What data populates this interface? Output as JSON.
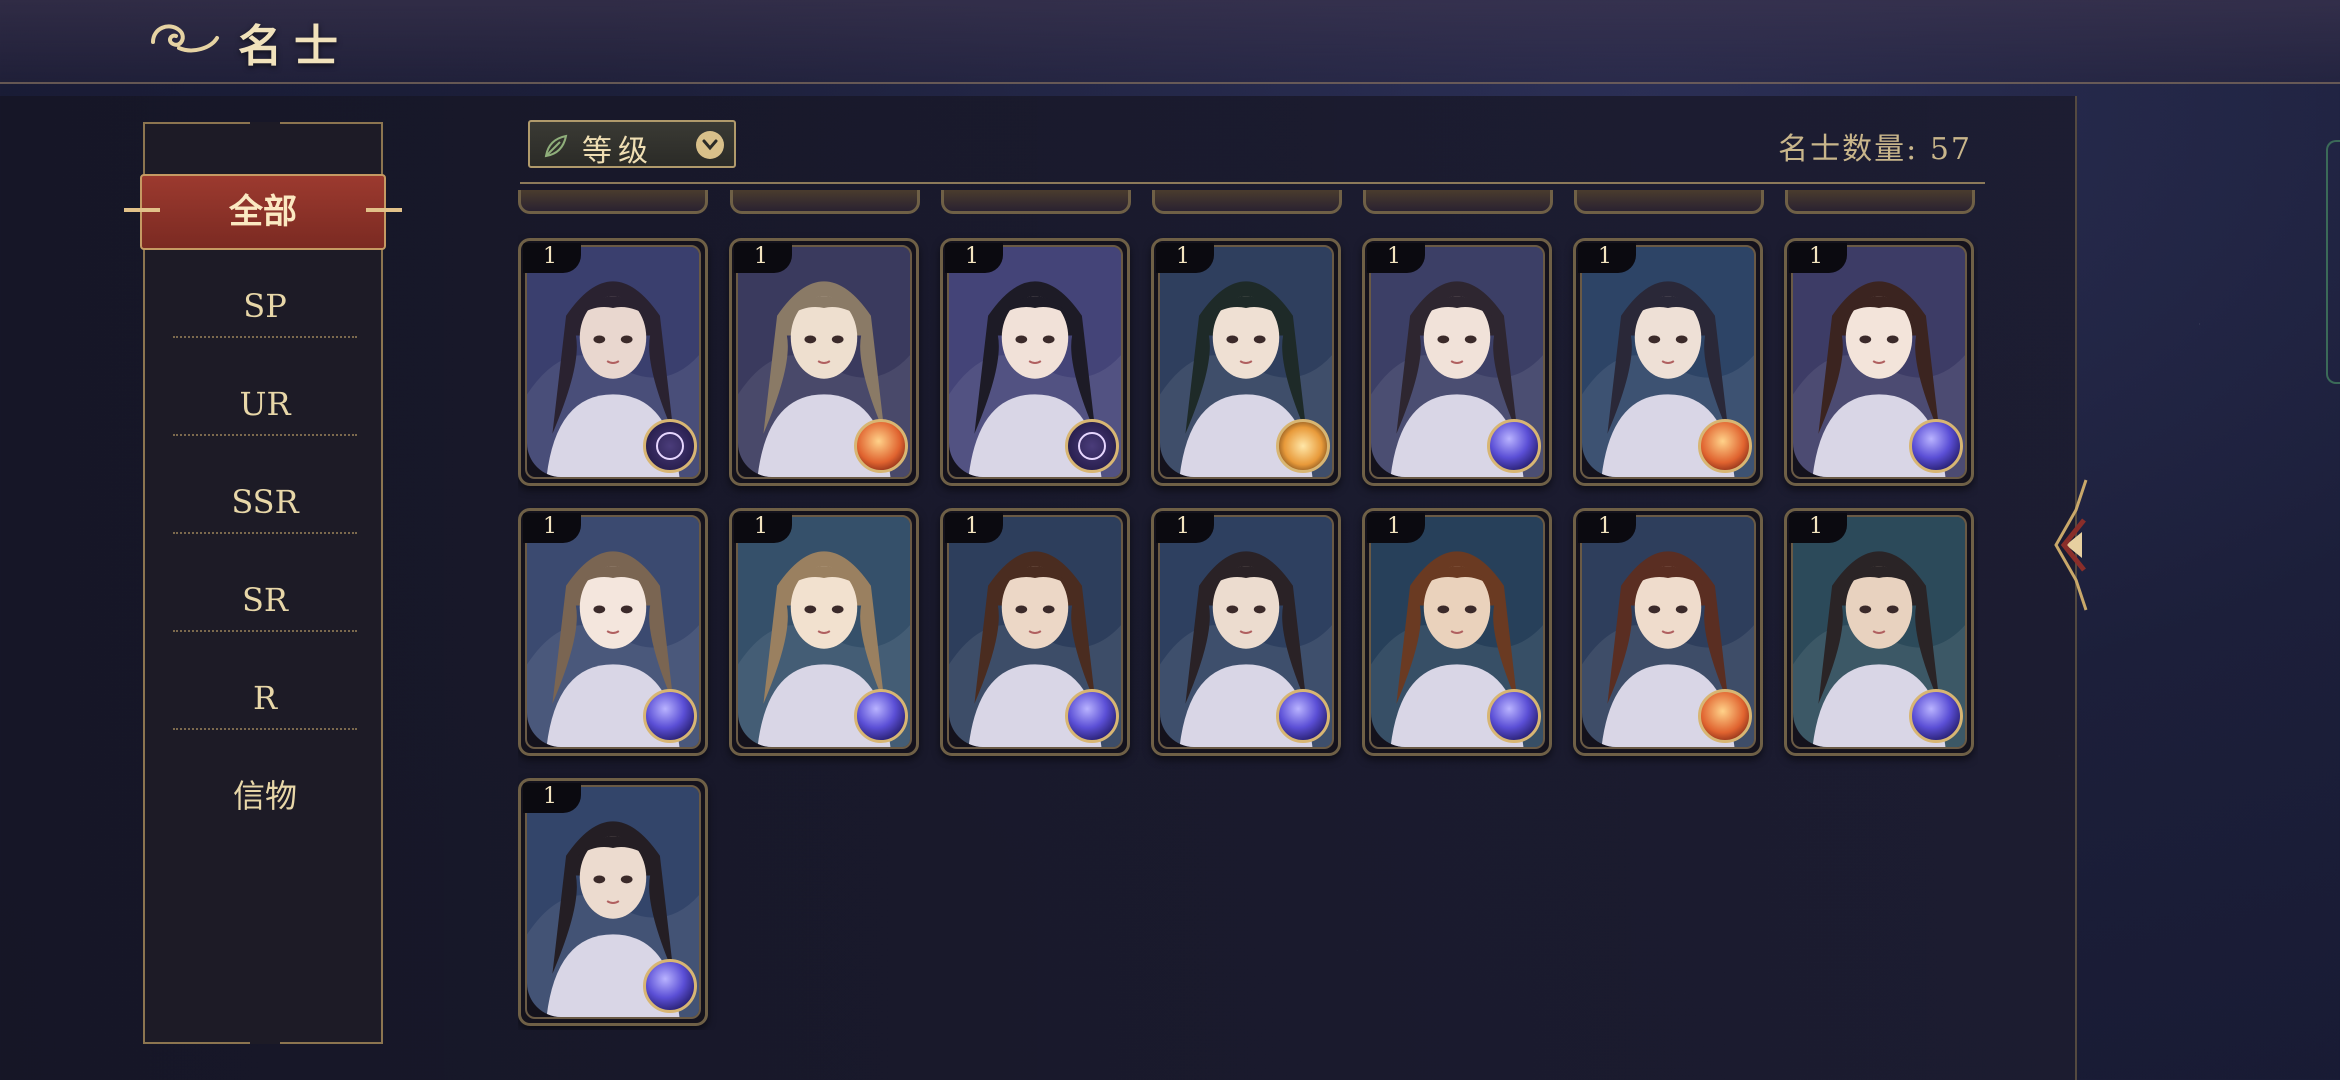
{
  "header": {
    "title": "名士"
  },
  "sidebar": {
    "active": "全部",
    "items": [
      {
        "label": "SP"
      },
      {
        "label": "UR"
      },
      {
        "label": "SSR"
      },
      {
        "label": "SR"
      },
      {
        "label": "R"
      },
      {
        "label": "信物"
      }
    ]
  },
  "toolbar": {
    "sort_label": "等级",
    "count_text": "名士数量: 57"
  },
  "cards": [
    {
      "level": "1",
      "element": "moon",
      "hair": "#2a2230",
      "skin": "#e9d7cf",
      "bg": "#3a3f6e"
    },
    {
      "level": "1",
      "element": "orange",
      "hair": "#8a7a66",
      "skin": "#eedfcf",
      "bg": "#3a3a5e"
    },
    {
      "level": "1",
      "element": "moon",
      "hair": "#1d1b26",
      "skin": "#f1e1d8",
      "bg": "#444478"
    },
    {
      "level": "1",
      "element": "sun",
      "hair": "#1e2a28",
      "skin": "#efe0d3",
      "bg": "#2f3f5e"
    },
    {
      "level": "1",
      "element": "purple",
      "hair": "#2e2630",
      "skin": "#f1e2d9",
      "bg": "#3c3f66"
    },
    {
      "level": "1",
      "element": "orange",
      "hair": "#2a2838",
      "skin": "#eee0d6",
      "bg": "#2d4466"
    },
    {
      "level": "1",
      "element": "purple",
      "hair": "#3b2420",
      "skin": "#f3e4da",
      "bg": "#3d3c66"
    },
    {
      "level": "1",
      "element": "purple",
      "hair": "#7a6552",
      "skin": "#f4e6dd",
      "bg": "#3b4a70"
    },
    {
      "level": "1",
      "element": "purple",
      "hair": "#9a8060",
      "skin": "#f2e1cf",
      "bg": "#35506a"
    },
    {
      "level": "1",
      "element": "purple",
      "hair": "#4a2c20",
      "skin": "#ecd7c6",
      "bg": "#2d3e5c"
    },
    {
      "level": "1",
      "element": "purple",
      "hair": "#2a2226",
      "skin": "#ecdccf",
      "bg": "#2e4060"
    },
    {
      "level": "1",
      "element": "purple",
      "hair": "#6a3a22",
      "skin": "#ead2bc",
      "bg": "#27405a"
    },
    {
      "level": "1",
      "element": "orange",
      "hair": "#5a2e22",
      "skin": "#efdccc",
      "bg": "#2e3e5c"
    },
    {
      "level": "1",
      "element": "purple",
      "hair": "#2a2426",
      "skin": "#e8d2bf",
      "bg": "#2c4a5a"
    },
    {
      "level": "1",
      "element": "purple",
      "hair": "#241e24",
      "skin": "#ecdbcf",
      "bg": "#33456a"
    }
  ]
}
